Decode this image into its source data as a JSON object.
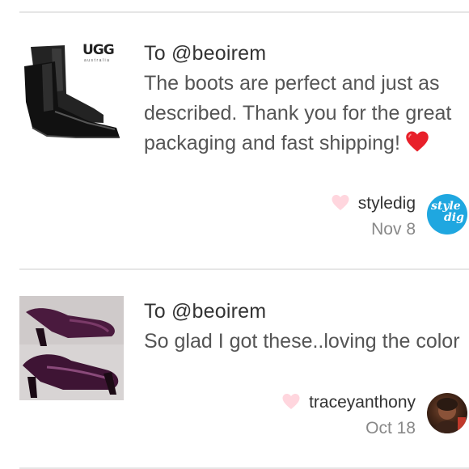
{
  "reviews": [
    {
      "recipient": "To @beoirem",
      "message": "The boots are perfect and just as described. Thank you for the great packaging and fast shipping!",
      "product_image": {
        "brand_text": "UGG",
        "brand_sub": "australia"
      },
      "username": "styledig",
      "date": "Nov 8",
      "avatar_text": [
        "style",
        "dig"
      ]
    },
    {
      "recipient": "To @beoirem",
      "message": "So glad I got these..loving the color",
      "username": "traceyanthony",
      "date": "Oct 18"
    }
  ],
  "colors": {
    "heart_like": "#ffd6de",
    "heart_emoji": "#e8202a",
    "avatar_styledig": "#1fa7e0",
    "divider": "#e6e6e6"
  }
}
